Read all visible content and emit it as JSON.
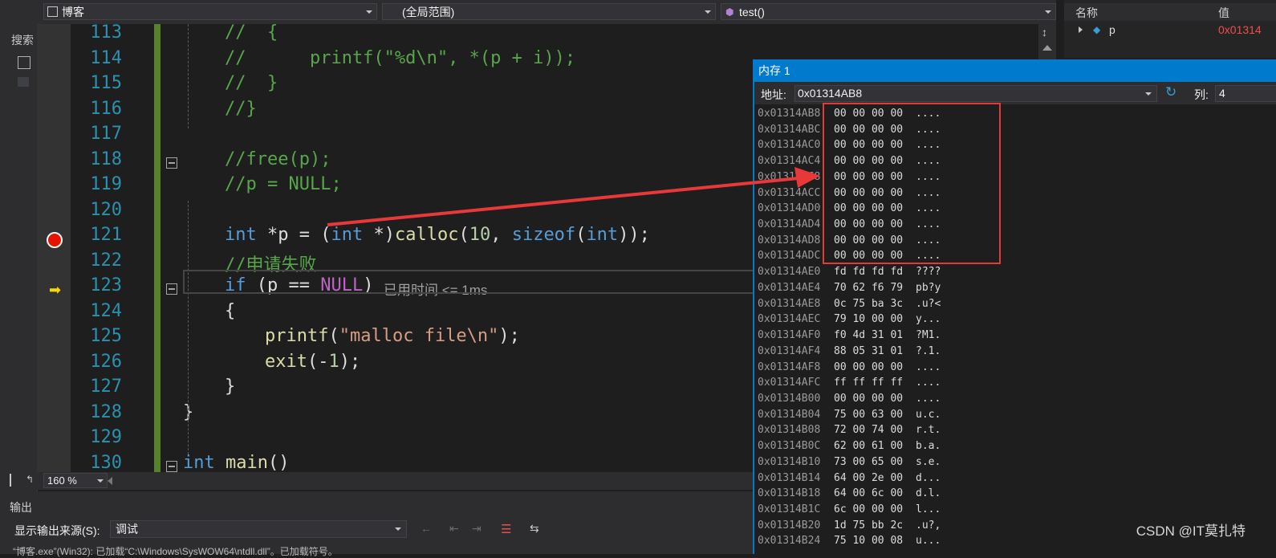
{
  "sidebar": {
    "search_label": "搜索"
  },
  "topbar": {
    "project": "博客",
    "scope": "(全局范围)",
    "member": "test()"
  },
  "editor": {
    "lines": [
      {
        "num": "113",
        "text": "//  {"
      },
      {
        "num": "114",
        "text": "//      printf(\"%d\\n\", *(p + i));"
      },
      {
        "num": "115",
        "text": "//  }"
      },
      {
        "num": "116",
        "text": "//}"
      },
      {
        "num": "117",
        "text": ""
      },
      {
        "num": "118",
        "text": "//free(p);"
      },
      {
        "num": "119",
        "text": "//p = NULL;"
      },
      {
        "num": "120",
        "text": ""
      },
      {
        "num": "121",
        "text": "int *p = (int *)calloc(10, sizeof(int));"
      },
      {
        "num": "122",
        "text": "//申请失败"
      },
      {
        "num": "123",
        "text": "if (p == NULL)"
      },
      {
        "num": "124",
        "text": "{"
      },
      {
        "num": "125",
        "text": "printf(\"malloc file\\n\");"
      },
      {
        "num": "126",
        "text": "exit(-1);"
      },
      {
        "num": "127",
        "text": "}"
      },
      {
        "num": "128",
        "text": "}"
      },
      {
        "num": "129",
        "text": ""
      },
      {
        "num": "130",
        "text": "int main()"
      }
    ],
    "elapsed_label": "已用时间 <= 1ms",
    "zoom": "160 %"
  },
  "output": {
    "title": "输出",
    "source_label": "显示输出来源(S):",
    "source_value": "调试",
    "text": "“博客.exe”(Win32): 已加载“C:\\Windows\\SysWOW64\\ntdll.dll”。已加载符号。"
  },
  "watch": {
    "col_name": "名称",
    "col_value": "值",
    "var_name": "p",
    "var_value": "0x01314"
  },
  "memory": {
    "title": "内存 1",
    "address_label": "地址:",
    "address": "0x01314AB8",
    "columns_label": "列:",
    "columns": "4",
    "rows": [
      {
        "addr": "0x01314AB8",
        "bytes": "00 00 00 00",
        "chars": "...."
      },
      {
        "addr": "0x01314ABC",
        "bytes": "00 00 00 00",
        "chars": "...."
      },
      {
        "addr": "0x01314AC0",
        "bytes": "00 00 00 00",
        "chars": "...."
      },
      {
        "addr": "0x01314AC4",
        "bytes": "00 00 00 00",
        "chars": "...."
      },
      {
        "addr": "0x01314AC8",
        "bytes": "00 00 00 00",
        "chars": "...."
      },
      {
        "addr": "0x01314ACC",
        "bytes": "00 00 00 00",
        "chars": "...."
      },
      {
        "addr": "0x01314AD0",
        "bytes": "00 00 00 00",
        "chars": "...."
      },
      {
        "addr": "0x01314AD4",
        "bytes": "00 00 00 00",
        "chars": "...."
      },
      {
        "addr": "0x01314AD8",
        "bytes": "00 00 00 00",
        "chars": "...."
      },
      {
        "addr": "0x01314ADC",
        "bytes": "00 00 00 00",
        "chars": "...."
      },
      {
        "addr": "0x01314AE0",
        "bytes": "fd fd fd fd",
        "chars": "????"
      },
      {
        "addr": "0x01314AE4",
        "bytes": "70 62 f6 79",
        "chars": "pb?y"
      },
      {
        "addr": "0x01314AE8",
        "bytes": "0c 75 ba 3c",
        "chars": ".u?<"
      },
      {
        "addr": "0x01314AEC",
        "bytes": "79 10 00 00",
        "chars": "y..."
      },
      {
        "addr": "0x01314AF0",
        "bytes": "f0 4d 31 01",
        "chars": "?M1."
      },
      {
        "addr": "0x01314AF4",
        "bytes": "88 05 31 01",
        "chars": "?.1."
      },
      {
        "addr": "0x01314AF8",
        "bytes": "00 00 00 00",
        "chars": "...."
      },
      {
        "addr": "0x01314AFC",
        "bytes": "ff ff ff ff",
        "chars": "...."
      },
      {
        "addr": "0x01314B00",
        "bytes": "00 00 00 00",
        "chars": "...."
      },
      {
        "addr": "0x01314B04",
        "bytes": "75 00 63 00",
        "chars": "u.c."
      },
      {
        "addr": "0x01314B08",
        "bytes": "72 00 74 00",
        "chars": "r.t."
      },
      {
        "addr": "0x01314B0C",
        "bytes": "62 00 61 00",
        "chars": "b.a."
      },
      {
        "addr": "0x01314B10",
        "bytes": "73 00 65 00",
        "chars": "s.e."
      },
      {
        "addr": "0x01314B14",
        "bytes": "64 00 2e 00",
        "chars": "d..."
      },
      {
        "addr": "0x01314B18",
        "bytes": "64 00 6c 00",
        "chars": "d.l."
      },
      {
        "addr": "0x01314B1C",
        "bytes": "6c 00 00 00",
        "chars": "l..."
      },
      {
        "addr": "0x01314B20",
        "bytes": "1d 75 bb 2c",
        "chars": ".u?,"
      },
      {
        "addr": "0x01314B24",
        "bytes": "75 10 00 08",
        "chars": "u..."
      }
    ]
  },
  "watermark": "CSDN @IT莫扎特",
  "colors": {
    "accent": "#007acc",
    "highlight": "#e03a3a",
    "breakpoint": "#e51400"
  }
}
